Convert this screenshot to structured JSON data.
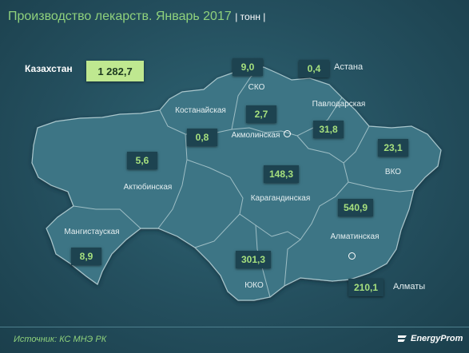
{
  "title": "Производство лекарств. Январь 2017",
  "unit": "| тонн |",
  "country": {
    "name": "Казахстан",
    "total": "1 282,7"
  },
  "regions": [
    {
      "id": "sko",
      "name": "СКО",
      "value": "9,0"
    },
    {
      "id": "kostanay",
      "name": "Костанайская",
      "value": "0,8"
    },
    {
      "id": "akmola",
      "name": "Акмолинская",
      "value": "2,7"
    },
    {
      "id": "pavlodar",
      "name": "Павлодарская",
      "value": "31,8"
    },
    {
      "id": "vko",
      "name": "ВКО",
      "value": "23,1"
    },
    {
      "id": "aktobe",
      "name": "Актюбинская",
      "value": "5,6"
    },
    {
      "id": "karaganda",
      "name": "Карагандинская",
      "value": "148,3"
    },
    {
      "id": "mangystau",
      "name": "Мангистауская",
      "value": "8,9"
    },
    {
      "id": "almaty_obl",
      "name": "Алматинская",
      "value": "540,9"
    },
    {
      "id": "yuko",
      "name": "ЮКО",
      "value": "301,3"
    }
  ],
  "cities": [
    {
      "id": "astana",
      "name": "Астана",
      "value": "0,4"
    },
    {
      "id": "almaty",
      "name": "Алматы",
      "value": "210,1"
    }
  ],
  "colors": {
    "title": "#8fd17c",
    "value_text": "#a6e07e",
    "total_box": "#bfe890",
    "map_fill": "#3d7585",
    "border": "#a9c6cc"
  },
  "footer": {
    "source": "Источник: КС МНЭ РК",
    "brand": "EnergyProm"
  }
}
